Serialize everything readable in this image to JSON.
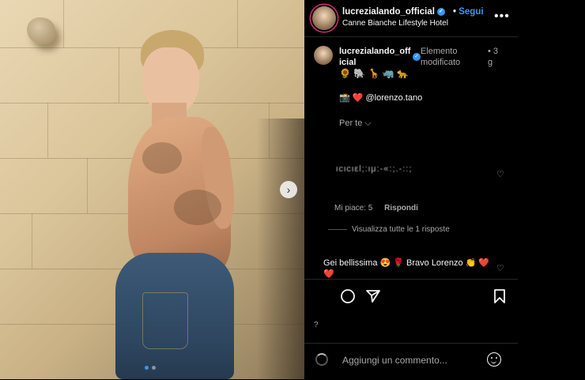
{
  "header": {
    "username": "lucrezialando_official",
    "follow_label": "Segui",
    "separator": "•",
    "location": "Canne Bianche Lifestyle Hotel",
    "more_label": "•••"
  },
  "post": {
    "next_label": "›",
    "dots_count": 2
  },
  "caption": {
    "username": "lucrezialando_official",
    "edited_label": "Elemento modificato",
    "separator": "•",
    "time": "3 g",
    "emoji_line": "🌻 🐘 🦒 🦏 🐆",
    "mention_line": "📸 ❤️ @lorenzo.tano",
    "per_te_label": "Per te ⌵"
  },
  "comments": [
    {
      "text_garbled": "ιcιcιεl;:ιμ:-«:;.-::;",
      "likes_text": "Mi piace: 5",
      "reply_label": "Rispondi",
      "view_replies": "Visualizza tutte le 1 risposte"
    },
    {
      "text": "Gei bellissima 😍 🌹 Bravo Lorenzo 👏 ❤️ ❤️"
    }
  ],
  "actions": {
    "comment_icon": "comment-icon",
    "share_icon": "share-icon",
    "save_icon": "bookmark-icon"
  },
  "composer": {
    "placeholder": "Aggiungi un commento..."
  },
  "colors": {
    "accent": "#3897f0",
    "background": "#000000",
    "muted": "#a8a8a8"
  }
}
